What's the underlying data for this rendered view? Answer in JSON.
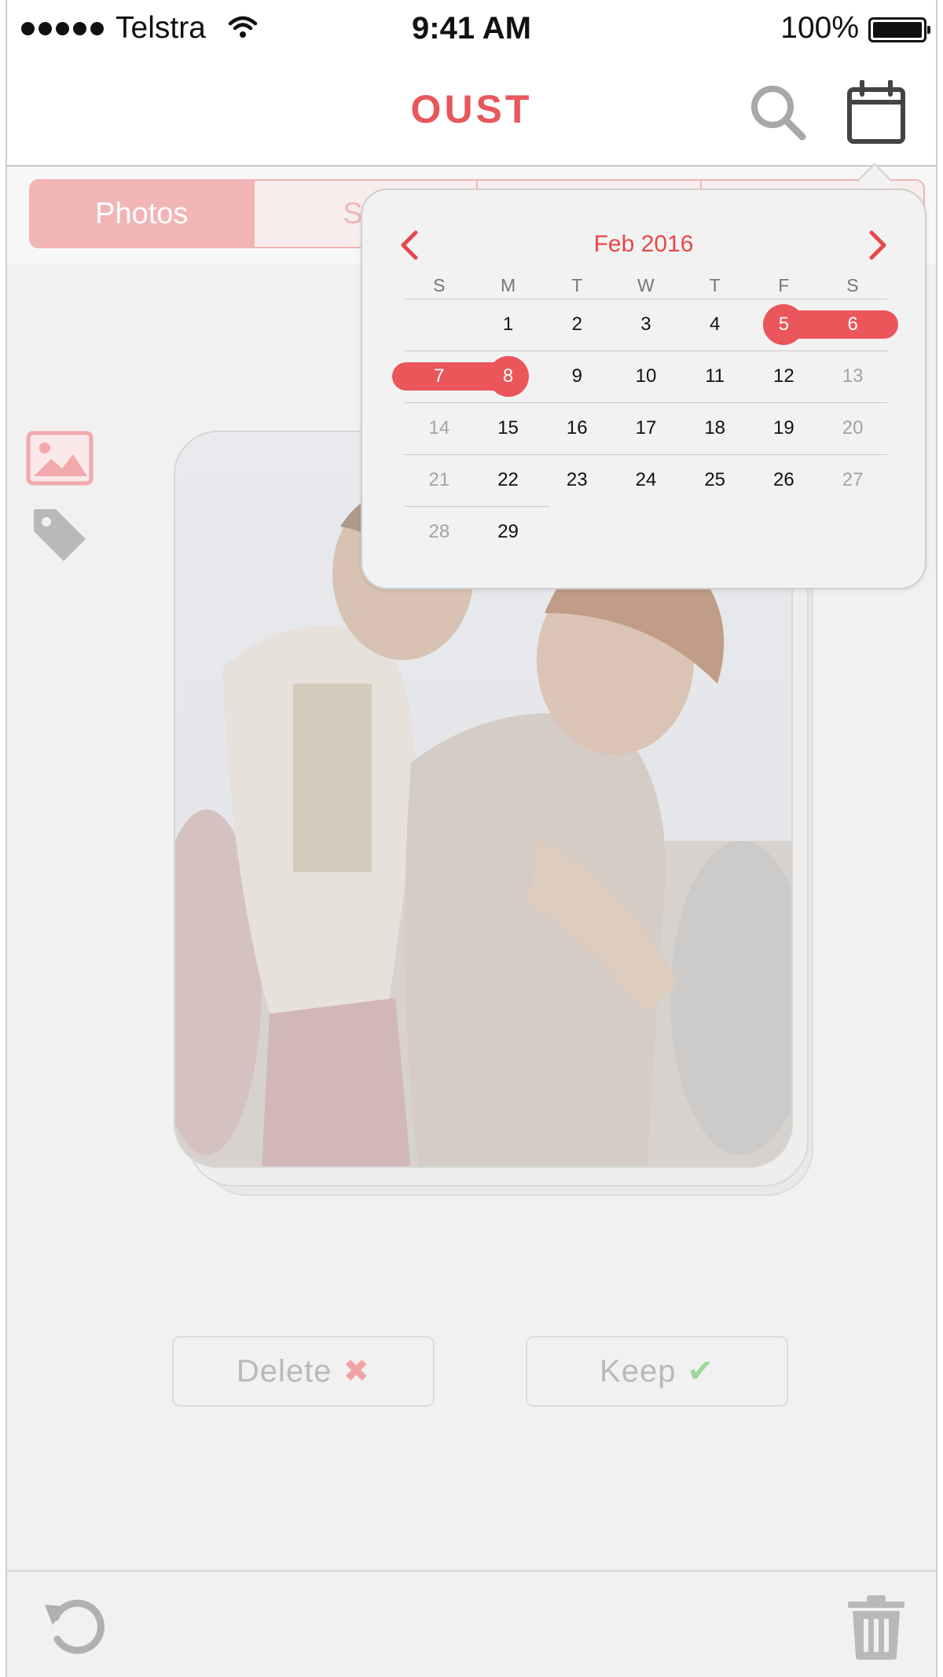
{
  "status_bar": {
    "carrier": "Telstra",
    "time": "9:41 AM",
    "battery": "100%"
  },
  "nav": {
    "title": "OUST",
    "search_icon": "search-icon",
    "calendar_icon": "calendar-icon"
  },
  "segments": [
    {
      "label": "Photos",
      "active": true
    },
    {
      "label": "Sta",
      "active": false
    },
    {
      "label": "",
      "active": false
    },
    {
      "label": "",
      "active": false
    }
  ],
  "calendar": {
    "month_label": "Feb 2016",
    "prev_icon": "chevron-left-icon",
    "next_icon": "chevron-right-icon",
    "weekdays": [
      "S",
      "M",
      "T",
      "W",
      "T",
      "F",
      "S"
    ],
    "weeks": [
      [
        null,
        1,
        2,
        3,
        4,
        5,
        6
      ],
      [
        7,
        8,
        9,
        10,
        11,
        12,
        13
      ],
      [
        14,
        15,
        16,
        17,
        18,
        19,
        20
      ],
      [
        21,
        22,
        23,
        24,
        25,
        26,
        27
      ],
      [
        28,
        29,
        null,
        null,
        null,
        null,
        null
      ]
    ],
    "selected_range": {
      "start": 5,
      "end": 8
    },
    "accent_color": "#ea5659"
  },
  "side_icons": [
    "image-icon",
    "tag-icon"
  ],
  "actions": {
    "delete_label": "Delete",
    "keep_label": "Keep"
  },
  "toolbar": {
    "undo_icon": "undo-icon",
    "trash_icon": "trash-icon"
  },
  "colors": {
    "brand": "#e8575a",
    "keep": "#9cd79c",
    "delete": "#f2a3a6"
  }
}
